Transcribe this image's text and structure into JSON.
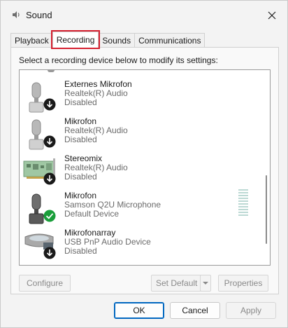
{
  "window": {
    "title": "Sound",
    "close_icon": "close-icon"
  },
  "tabs": [
    {
      "label": "Playback",
      "active": false
    },
    {
      "label": "Recording",
      "active": true
    },
    {
      "label": "Sounds",
      "active": false
    },
    {
      "label": "Communications",
      "active": false
    }
  ],
  "instruction": "Select a recording device below to modify its settings:",
  "devices": [
    {
      "name": "Externes Mikrofon",
      "driver": "Realtek(R) Audio",
      "status": "Disabled",
      "icon": "microphone-icon",
      "badge": "disabled-arrow-badge"
    },
    {
      "name": "Mikrofon",
      "driver": "Realtek(R) Audio",
      "status": "Disabled",
      "icon": "microphone-icon",
      "badge": "disabled-arrow-badge"
    },
    {
      "name": "Stereomix",
      "driver": "Realtek(R) Audio",
      "status": "Disabled",
      "icon": "sound-card-icon",
      "badge": "disabled-arrow-badge"
    },
    {
      "name": "Mikrofon",
      "driver": "Samson Q2U Microphone",
      "status": "Default Device",
      "icon": "microphone-icon",
      "badge": "default-check-badge"
    },
    {
      "name": "Mikrofonarray",
      "driver": "USB PnP Audio Device",
      "status": "Disabled",
      "icon": "microphone-array-icon",
      "badge": "disabled-arrow-badge"
    }
  ],
  "buttons": {
    "configure": "Configure",
    "set_default": "Set Default",
    "properties": "Properties",
    "ok": "OK",
    "cancel": "Cancel",
    "apply": "Apply"
  },
  "colors": {
    "highlight_outline": "#d62030",
    "default_badge": "#1a9e3a",
    "primary_border": "#0067c0"
  }
}
